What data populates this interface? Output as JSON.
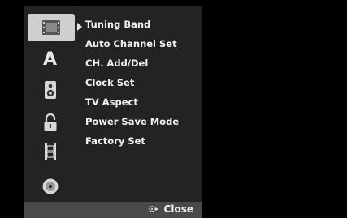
{
  "sidebar": {
    "items": [
      {
        "icon": "film-strip-icon",
        "selected": true
      },
      {
        "icon": "language-letter-a-icon",
        "glyph": "A",
        "selected": false
      },
      {
        "icon": "speaker-icon",
        "selected": false
      },
      {
        "icon": "padlock-icon",
        "selected": false
      },
      {
        "icon": "film-reel-icon",
        "selected": false
      },
      {
        "icon": "disc-icon",
        "selected": false
      }
    ]
  },
  "menu": {
    "items": [
      {
        "label": "Tuning Band"
      },
      {
        "label": "Auto Channel Set"
      },
      {
        "label": "CH. Add/Del"
      },
      {
        "label": "Clock Set"
      },
      {
        "label": "TV Aspect"
      },
      {
        "label": "Power Save Mode"
      },
      {
        "label": "Factory Set"
      }
    ]
  },
  "footer": {
    "close_label": "Close",
    "close_icon": "remote-return-icon"
  },
  "colors": {
    "background": "#000000",
    "panel": "#232323",
    "footer": "#4a4a4a",
    "selected": "#cfcfcf",
    "text": "#f2f2f2"
  }
}
